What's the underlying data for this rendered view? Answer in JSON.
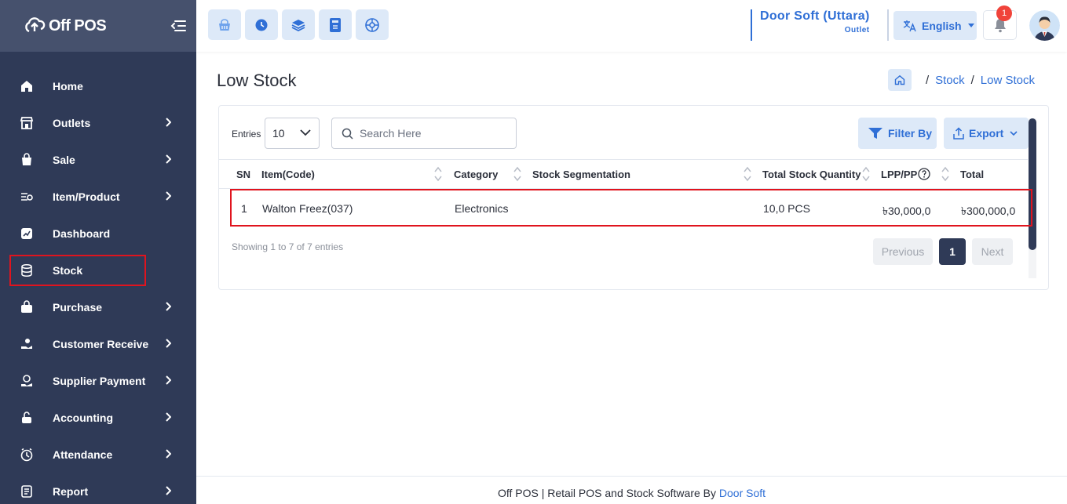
{
  "brand": {
    "name": "Off POS"
  },
  "sidebar": {
    "items": [
      {
        "label": "Home",
        "icon": "home-icon",
        "has_submenu": false
      },
      {
        "label": "Outlets",
        "icon": "store-icon",
        "has_submenu": true
      },
      {
        "label": "Sale",
        "icon": "basket-icon",
        "has_submenu": true
      },
      {
        "label": "Item/Product",
        "icon": "list-filter-icon",
        "has_submenu": true
      },
      {
        "label": "Dashboard",
        "icon": "chart-icon",
        "has_submenu": false
      },
      {
        "label": "Stock",
        "icon": "database-icon",
        "has_submenu": false,
        "active": true
      },
      {
        "label": "Purchase",
        "icon": "bag-icon",
        "has_submenu": true
      },
      {
        "label": "Customer Receive",
        "icon": "hand-coin-icon",
        "has_submenu": true
      },
      {
        "label": "Supplier Payment",
        "icon": "payment-icon",
        "has_submenu": true
      },
      {
        "label": "Accounting",
        "icon": "lock-icon",
        "has_submenu": true
      },
      {
        "label": "Attendance",
        "icon": "clock-icon",
        "has_submenu": true
      },
      {
        "label": "Report",
        "icon": "report-icon",
        "has_submenu": true
      }
    ]
  },
  "topbar": {
    "quick_actions": [
      "pos-basket-icon",
      "clock-icon",
      "layers-icon",
      "calculator-icon",
      "settings-wheel-icon"
    ],
    "outlet": {
      "name": "Door Soft (Uttara)",
      "sub": "Outlet"
    },
    "language": "English",
    "notification_count": "1"
  },
  "page": {
    "title": "Low Stock",
    "breadcrumb": [
      "Stock",
      "Low Stock"
    ]
  },
  "table_controls": {
    "entries_label": "Entries",
    "entries_value": "10",
    "search_placeholder": "Search Here",
    "filter_label": "Filter By",
    "export_label": "Export"
  },
  "table": {
    "columns": [
      "SN",
      "Item(Code)",
      "Category",
      "Stock Segmentation",
      "Total Stock Quantity",
      "LPP/PP",
      "Total"
    ],
    "rows": [
      {
        "sn": "1",
        "item": "Walton Freez(037)",
        "category": "Electronics",
        "segmentation": "",
        "quantity": "10,0 PCS",
        "lpp": "৳30,000,0",
        "total": "৳300,000,0"
      }
    ]
  },
  "pagination": {
    "showing": "Showing 1 to 7 of 7 entries",
    "prev": "Previous",
    "current": "1",
    "next": "Next"
  },
  "footer": {
    "text": "Off POS | Retail POS and Stock Software By",
    "link": "Door Soft"
  },
  "colors": {
    "sidebar_bg": "#2f3a57",
    "accent": "#2f6fd6",
    "highlight": "#e0141e"
  }
}
